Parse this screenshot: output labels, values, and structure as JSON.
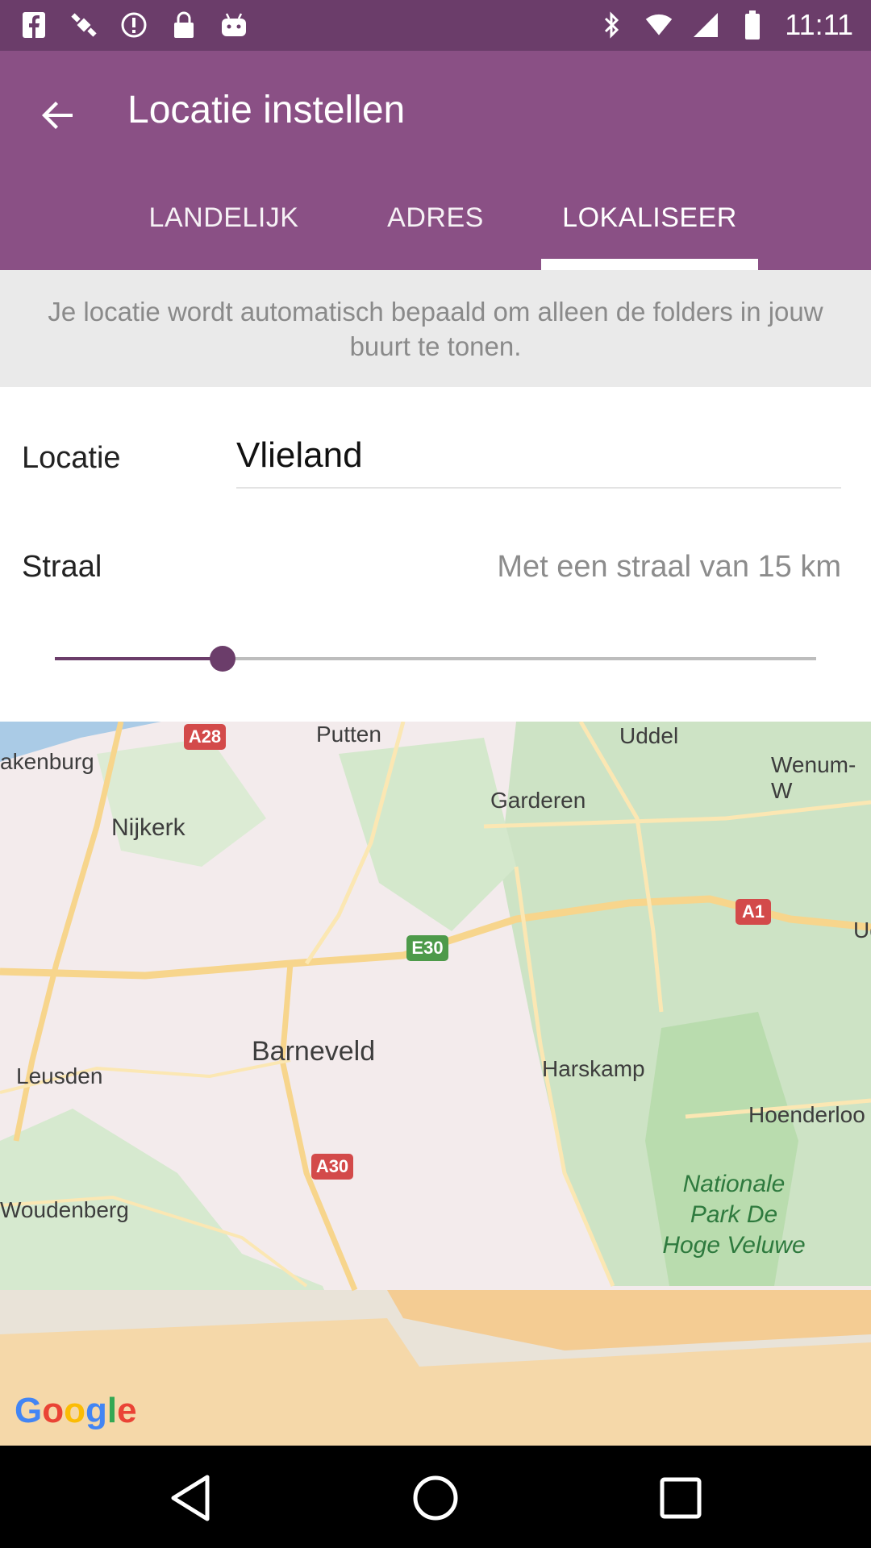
{
  "status_bar": {
    "time": "11:11",
    "left_icons": [
      "facebook-icon",
      "fake-gps-icon",
      "alert-icon",
      "lock-icon",
      "android-icon"
    ],
    "right_icons": [
      "bluetooth-icon",
      "wifi-icon",
      "cellular-icon",
      "battery-icon"
    ]
  },
  "app_bar": {
    "title": "Locatie instellen",
    "back_icon": "arrow-left-icon"
  },
  "tabs": [
    {
      "label": "LANDELIJK",
      "active": false
    },
    {
      "label": "ADRES",
      "active": false
    },
    {
      "label": "LOKALISEER",
      "active": true
    }
  ],
  "info_text": "Je locatie wordt automatisch bepaald om alleen de folders in jouw buurt te tonen.",
  "form": {
    "location_label": "Locatie",
    "location_value": "Vlieland",
    "radius_label": "Straal",
    "radius_text": "Met een straal van 15 km",
    "slider_level": 0.22
  },
  "map": {
    "places": [
      "Putten",
      "Uddel",
      "akenburg",
      "Wenum-W",
      "Garderen",
      "Nijkerk",
      "Barneveld",
      "Harskamp",
      "Leusden",
      "Hoenderloo",
      "Woudenberg",
      "Ud"
    ],
    "park_lines": [
      "Nationale",
      "Park De",
      "Hoge Veluwe"
    ],
    "road_shields": [
      "A28",
      "E30",
      "A1",
      "A30"
    ],
    "attribution": "Google"
  },
  "colors": {
    "status_bar": "#6b3d6a",
    "app_bar": "#8a5085",
    "accent": "#6b3d6a"
  },
  "nav_bar": {
    "icons": [
      "back-triangle-icon",
      "home-circle-icon",
      "recents-square-icon"
    ]
  }
}
